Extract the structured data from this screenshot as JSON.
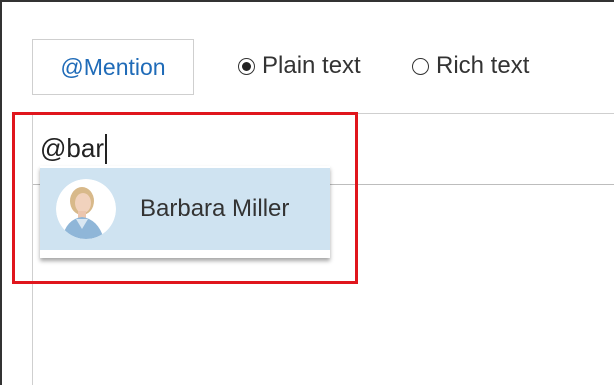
{
  "toolbar": {
    "mention_label": "@Mention",
    "format_options": [
      {
        "label": "Plain text",
        "selected": true
      },
      {
        "label": "Rich text",
        "selected": false
      }
    ]
  },
  "editor": {
    "typed_text": "@bar"
  },
  "suggestions": [
    {
      "name": "Barbara Miller",
      "avatar": "user-photo-avatar"
    }
  ],
  "colors": {
    "link_blue": "#1f6bb8",
    "suggestion_highlight": "#cfe3f1",
    "annotation_red": "#e0161d"
  }
}
